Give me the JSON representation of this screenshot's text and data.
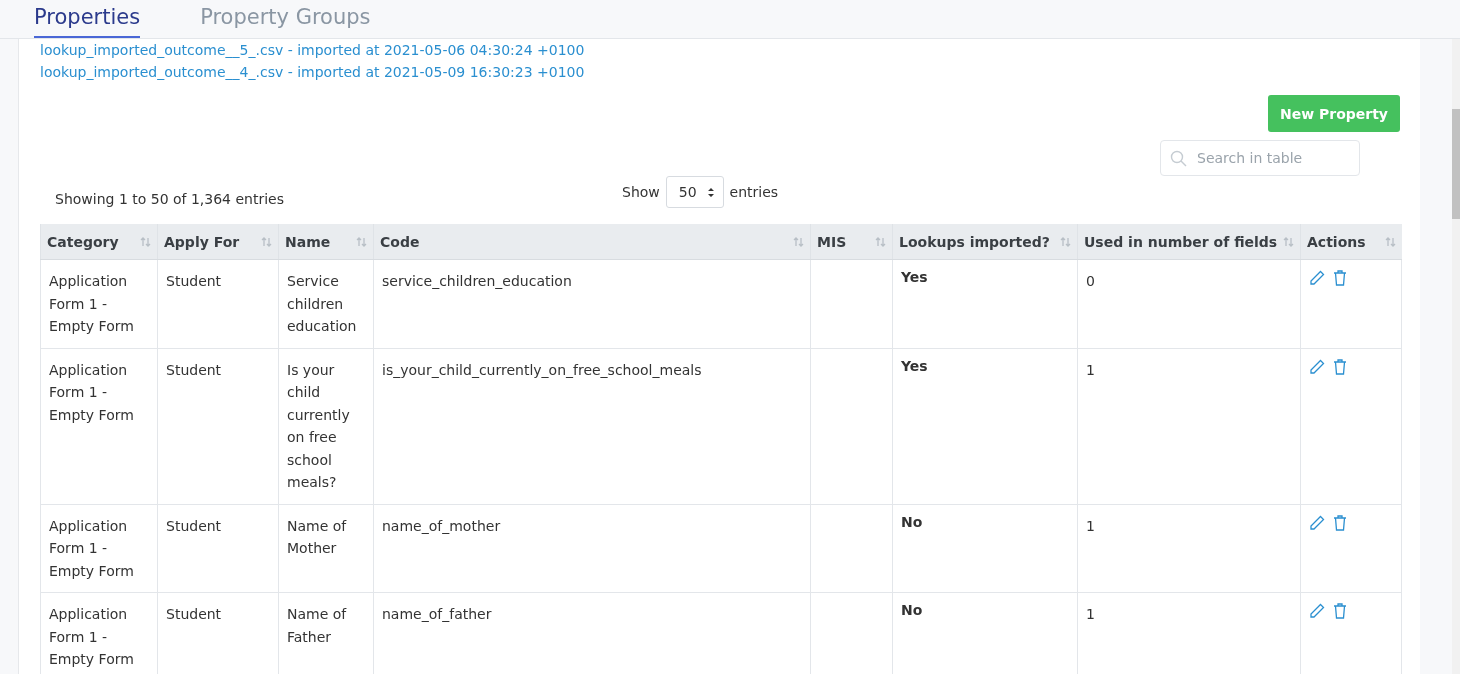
{
  "tabs": [
    {
      "label": "Properties",
      "selected": true
    },
    {
      "label": "Property Groups",
      "selected": false
    }
  ],
  "imports": [
    "lookup_imported_outcome__5_.csv - imported at 2021-05-06 04:30:24 +0100",
    "lookup_imported_outcome__4_.csv - imported at 2021-05-09 16:30:23 +0100"
  ],
  "new_button": "New Property",
  "search": {
    "placeholder": "Search in table"
  },
  "info": "Showing 1 to 50 of 1,364 entries",
  "length": {
    "prefix": "Show",
    "value": "50",
    "suffix": "entries"
  },
  "table": {
    "columns": [
      "Category",
      "Apply For",
      "Name",
      "Code",
      "MIS",
      "Lookups imported?",
      "Used in number of fields",
      "Actions"
    ],
    "rows": [
      {
        "category": "Application Form 1 - Empty Form",
        "apply_for": "Student",
        "name": "Service children education",
        "code": "service_children_education",
        "mis": "",
        "lookups": "Yes",
        "used": "0"
      },
      {
        "category": "Application Form 1 - Empty Form",
        "apply_for": "Student",
        "name": "Is your child currently on free school meals?",
        "code": "is_your_child_currently_on_free_school_meals",
        "mis": "",
        "lookups": "Yes",
        "used": "1"
      },
      {
        "category": "Application Form 1 - Empty Form",
        "apply_for": "Student",
        "name": "Name of Mother",
        "code": "name_of_mother",
        "mis": "",
        "lookups": "No",
        "used": "1"
      },
      {
        "category": "Application Form 1 - Empty Form",
        "apply_for": "Student",
        "name": "Name of Father",
        "code": "name_of_father",
        "mis": "",
        "lookups": "No",
        "used": "1"
      }
    ]
  }
}
